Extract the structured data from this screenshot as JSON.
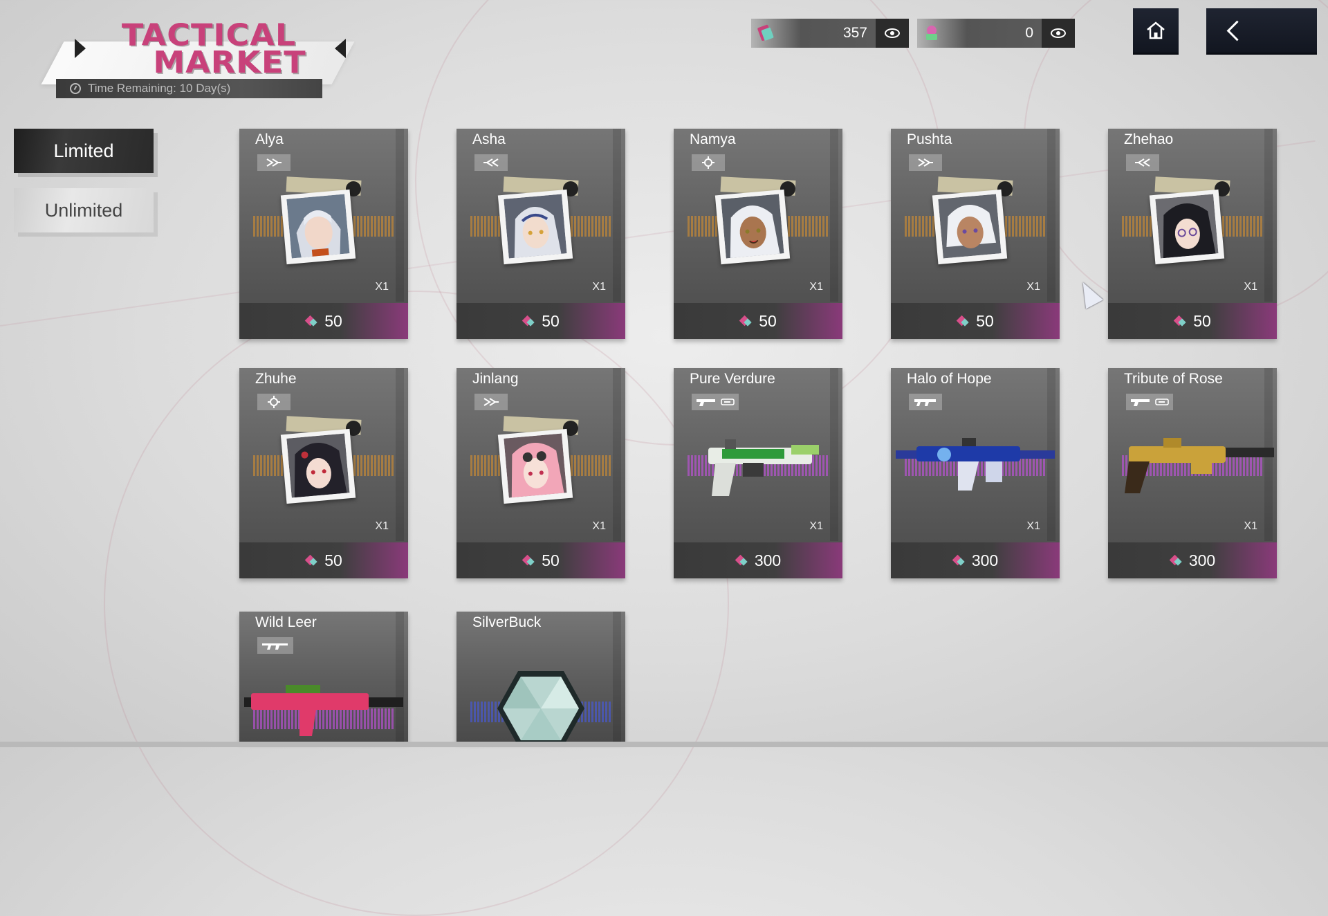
{
  "logo": {
    "title_line1": "TACTICAL",
    "title_line2": "MARKET",
    "time_remaining": "Time Remaining: 10 Day(s)"
  },
  "currencies": [
    {
      "icon": "tactical-ticket-icon",
      "value": "357",
      "color": "#c8417a"
    },
    {
      "icon": "pink-token-icon",
      "value": "0",
      "color": "#d866b0"
    }
  ],
  "nav": {
    "home_icon": "home-icon",
    "back_icon": "back-arrow-icon"
  },
  "tabs": {
    "limited": "Limited",
    "unlimited": "Unlimited",
    "active": "Limited"
  },
  "cards": [
    {
      "name": "Alya",
      "qty": "X1",
      "price": "50",
      "type": "character",
      "badge_icon": "assault-class-icon"
    },
    {
      "name": "Asha",
      "qty": "X1",
      "price": "50",
      "type": "character",
      "badge_icon": "guard-class-icon"
    },
    {
      "name": "Namya",
      "qty": "X1",
      "price": "50",
      "type": "character",
      "badge_icon": "support-class-icon"
    },
    {
      "name": "Pushta",
      "qty": "X1",
      "price": "50",
      "type": "character",
      "badge_icon": "assault-class-icon"
    },
    {
      "name": "Zhehao",
      "qty": "X1",
      "price": "50",
      "type": "character",
      "badge_icon": "guard-class-icon"
    },
    {
      "name": "Zhuhe",
      "qty": "X1",
      "price": "50",
      "type": "character",
      "badge_icon": "support-class-icon"
    },
    {
      "name": "Jinlang",
      "qty": "X1",
      "price": "50",
      "type": "character",
      "badge_icon": "assault-class-icon"
    },
    {
      "name": "Pure Verdure",
      "qty": "X1",
      "price": "300",
      "type": "weapon",
      "badge_icon": "pistol-icon"
    },
    {
      "name": "Halo of Hope",
      "qty": "X1",
      "price": "300",
      "type": "weapon",
      "badge_icon": "smg-icon"
    },
    {
      "name": "Tribute of Rose",
      "qty": "X1",
      "price": "300",
      "type": "weapon",
      "badge_icon": "pistol-icon"
    },
    {
      "name": "Wild Leer",
      "type": "weapon",
      "badge_icon": "rifle-icon"
    },
    {
      "name": "SilverBuck",
      "type": "item"
    }
  ]
}
